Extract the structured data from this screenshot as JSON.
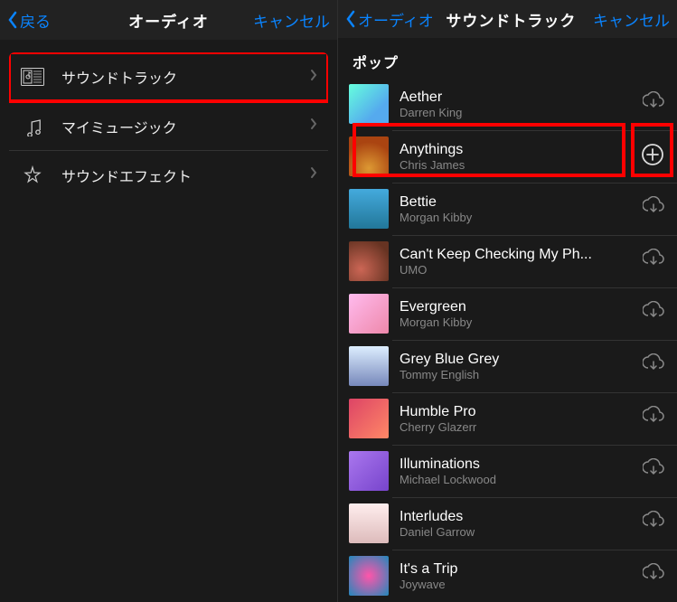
{
  "left": {
    "nav": {
      "back": "戻る",
      "title": "オーディオ",
      "cancel": "キャンセル"
    },
    "items": [
      {
        "label": "サウンドトラック"
      },
      {
        "label": "マイミュージック"
      },
      {
        "label": "サウンドエフェクト"
      }
    ]
  },
  "right": {
    "nav": {
      "back": "オーディオ",
      "title": "サウンドトラック",
      "cancel": "キャンセル"
    },
    "section": "ポップ",
    "tracks": [
      {
        "title": "Aether",
        "artist": "Darren King",
        "action": "download"
      },
      {
        "title": "Anythings",
        "artist": "Chris James",
        "action": "add"
      },
      {
        "title": "Bettie",
        "artist": "Morgan Kibby",
        "action": "download"
      },
      {
        "title": "Can't Keep Checking My Ph...",
        "artist": "UMO",
        "action": "download"
      },
      {
        "title": "Evergreen",
        "artist": "Morgan Kibby",
        "action": "download"
      },
      {
        "title": "Grey Blue Grey",
        "artist": "Tommy English",
        "action": "download"
      },
      {
        "title": "Humble Pro",
        "artist": "Cherry Glazerr",
        "action": "download"
      },
      {
        "title": "Illuminations",
        "artist": "Michael Lockwood",
        "action": "download"
      },
      {
        "title": "Interludes",
        "artist": "Daniel Garrow",
        "action": "download"
      },
      {
        "title": "It's a Trip",
        "artist": "Joywave",
        "action": "download"
      }
    ]
  }
}
